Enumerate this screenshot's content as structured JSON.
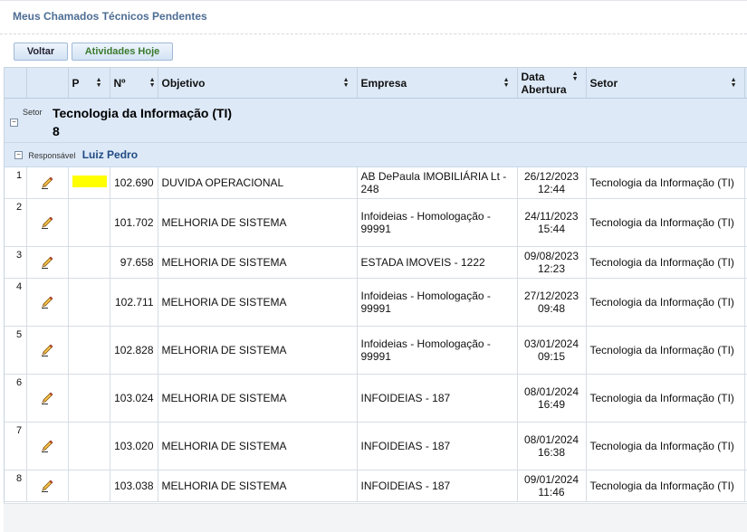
{
  "page": {
    "title": "Meus Chamados Técnicos Pendentes"
  },
  "toolbar": {
    "voltar": "Voltar",
    "atividades": "Atividades Hoje"
  },
  "columns": {
    "p": "P",
    "numero": "Nº",
    "objetivo": "Objetivo",
    "empresa": "Empresa",
    "data_line1": "Data",
    "data_line2": "Abertura",
    "setor": "Setor"
  },
  "group_setor": {
    "label": "Setor",
    "value": "Tecnologia da Informação (TI)",
    "count": "8"
  },
  "group_responsavel": {
    "label": "Responsável",
    "value": "Luiz Pedro"
  },
  "rows": [
    {
      "idx": "1",
      "priority_color": "#ffff00",
      "numero": "102.690",
      "objetivo": "DUVIDA OPERACIONAL",
      "empresa": "AB DePaula IMOBILIÁRIA Lt - 248",
      "data": "26/12/2023",
      "hora": "12:44",
      "setor": "Tecnologia da Informação (TI)"
    },
    {
      "idx": "2",
      "priority_color": "",
      "numero": "101.702",
      "objetivo": "MELHORIA DE SISTEMA",
      "empresa": "Infoideias - Homologação - 99991",
      "data": "24/11/2023",
      "hora": "15:44",
      "setor": "Tecnologia da Informação (TI)"
    },
    {
      "idx": "3",
      "priority_color": "",
      "numero": "97.658",
      "objetivo": "MELHORIA DE SISTEMA",
      "empresa": "ESTADA IMOVEIS - 1222",
      "data": "09/08/2023",
      "hora": "12:23",
      "setor": "Tecnologia da Informação (TI)"
    },
    {
      "idx": "4",
      "priority_color": "",
      "numero": "102.711",
      "objetivo": "MELHORIA DE SISTEMA",
      "empresa": "Infoideias - Homologação - 99991",
      "data": "27/12/2023",
      "hora": "09:48",
      "setor": "Tecnologia da Informação (TI)"
    },
    {
      "idx": "5",
      "priority_color": "",
      "numero": "102.828",
      "objetivo": "MELHORIA DE SISTEMA",
      "empresa": "Infoideias - Homologação - 99991",
      "data": "03/01/2024",
      "hora": "09:15",
      "setor": "Tecnologia da Informação (TI)"
    },
    {
      "idx": "6",
      "priority_color": "",
      "numero": "103.024",
      "objetivo": "MELHORIA DE SISTEMA",
      "empresa": "INFOIDEIAS - 187",
      "data": "08/01/2024",
      "hora": "16:49",
      "setor": "Tecnologia da Informação (TI)"
    },
    {
      "idx": "7",
      "priority_color": "",
      "numero": "103.020",
      "objetivo": "MELHORIA DE SISTEMA",
      "empresa": "INFOIDEIAS - 187",
      "data": "08/01/2024",
      "hora": "16:38",
      "setor": "Tecnologia da Informação (TI)"
    },
    {
      "idx": "8",
      "priority_color": "",
      "numero": "103.038",
      "objetivo": "MELHORIA DE SISTEMA",
      "empresa": "INFOIDEIAS - 187",
      "data": "09/01/2024",
      "hora": "11:46",
      "setor": "Tecnologia da Informação (TI)"
    }
  ]
}
